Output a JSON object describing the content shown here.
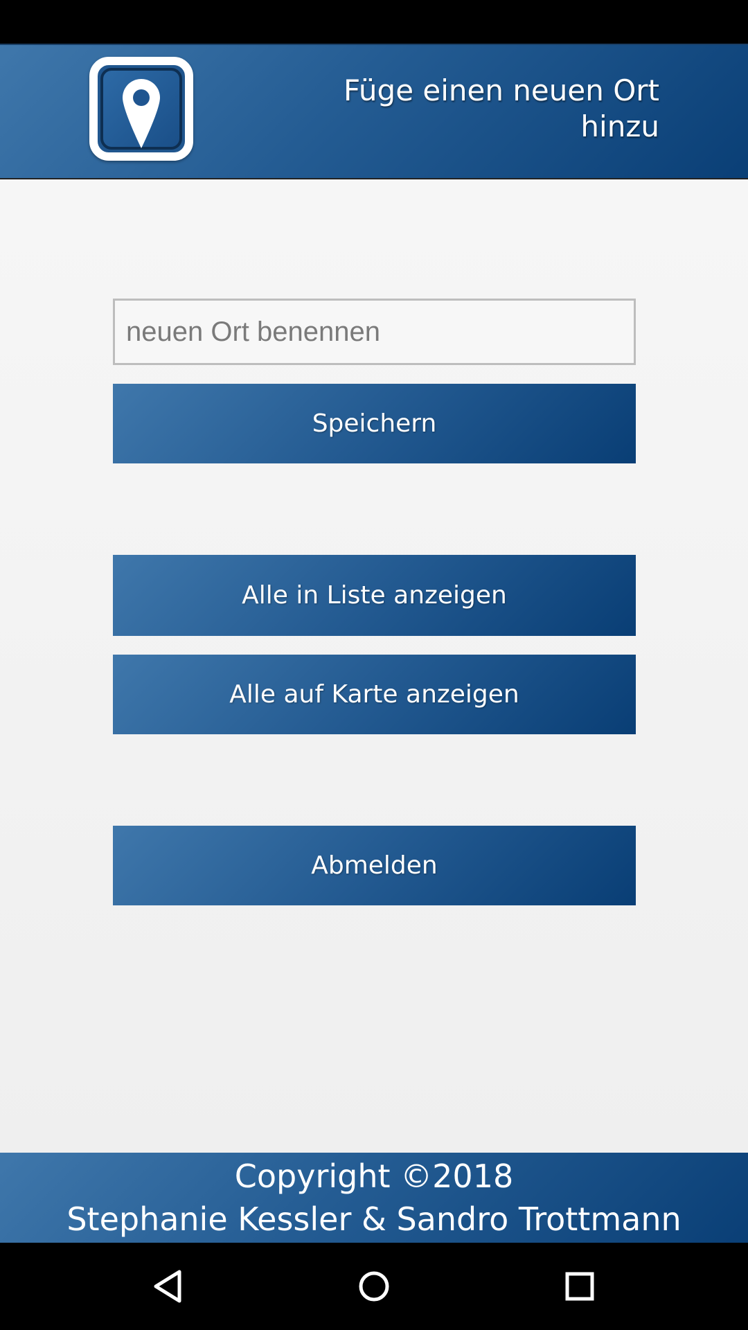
{
  "header": {
    "title": "Füge einen neuen Ort hinzu",
    "logo_icon": "map-pin-icon"
  },
  "form": {
    "place_name_placeholder": "neuen Ort benennen",
    "place_name_value": "",
    "save_label": "Speichern"
  },
  "actions": {
    "show_list_label": "Alle in Liste anzeigen",
    "show_map_label": "Alle auf Karte anzeigen",
    "logout_label": "Abmelden"
  },
  "footer": {
    "copyright": "Copyright ©2018",
    "authors": "Stephanie Kessler & Sandro Trottmann"
  },
  "nav": {
    "back_icon": "back-triangle-icon",
    "home_icon": "home-circle-icon",
    "recent_icon": "recent-apps-square-icon"
  },
  "colors": {
    "primary": "#245c93",
    "primary_dark": "#0a3f76",
    "primary_light": "#3f77ab",
    "background": "#f1f1f1",
    "text_on_primary": "#ffffff"
  }
}
